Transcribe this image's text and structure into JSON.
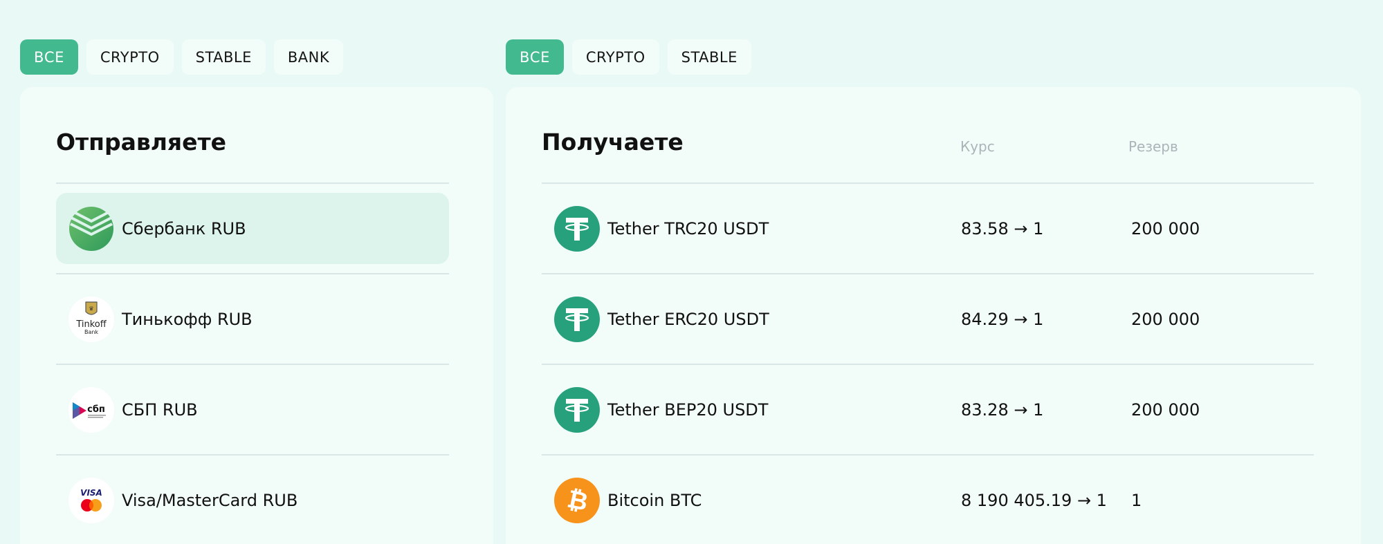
{
  "send": {
    "tabs": [
      {
        "label": "ВСЕ",
        "active": true
      },
      {
        "label": "CRYPTO",
        "active": false
      },
      {
        "label": "STABLE",
        "active": false
      },
      {
        "label": "BANK",
        "active": false
      }
    ],
    "title": "Отправляете",
    "items": [
      {
        "label": "Сбербанк RUB",
        "icon": "sberbank-logo-icon",
        "selected": true
      },
      {
        "label": "Тинькофф RUB",
        "icon": "tinkoff-logo-icon",
        "logo_text": "Tinkoff",
        "logo_subtext": "Bank"
      },
      {
        "label": "СБП RUB",
        "icon": "sbp-logo-icon",
        "logo_text": "сбп"
      },
      {
        "label": "Visa/MasterCard RUB",
        "icon": "visa-mastercard-logo-icon",
        "logo_text": "VISA"
      }
    ]
  },
  "receive": {
    "tabs": [
      {
        "label": "ВСЕ",
        "active": true
      },
      {
        "label": "CRYPTO",
        "active": false
      },
      {
        "label": "STABLE",
        "active": false
      }
    ],
    "title": "Получаете",
    "rate_header": "Курс",
    "reserve_header": "Резерв",
    "items": [
      {
        "label": "Tether TRC20 USDT",
        "icon": "tether-icon",
        "rate": "83.58 → 1",
        "reserve": "200 000"
      },
      {
        "label": "Tether ERC20 USDT",
        "icon": "tether-icon",
        "rate": "84.29 → 1",
        "reserve": "200 000"
      },
      {
        "label": "Tether BEP20 USDT",
        "icon": "tether-icon",
        "rate": "83.28 → 1",
        "reserve": "200 000"
      },
      {
        "label": "Bitcoin BTC",
        "icon": "bitcoin-icon",
        "rate": "8 190 405.19 → 1",
        "reserve": "1"
      }
    ]
  },
  "colors": {
    "accent": "#43b98f",
    "background": "#e9faf6",
    "panel": "#f2fcf9",
    "selected_row": "#dcf4ec",
    "tether": "#26a17b",
    "bitcoin": "#f7931a",
    "sberbank": "#21a038"
  }
}
